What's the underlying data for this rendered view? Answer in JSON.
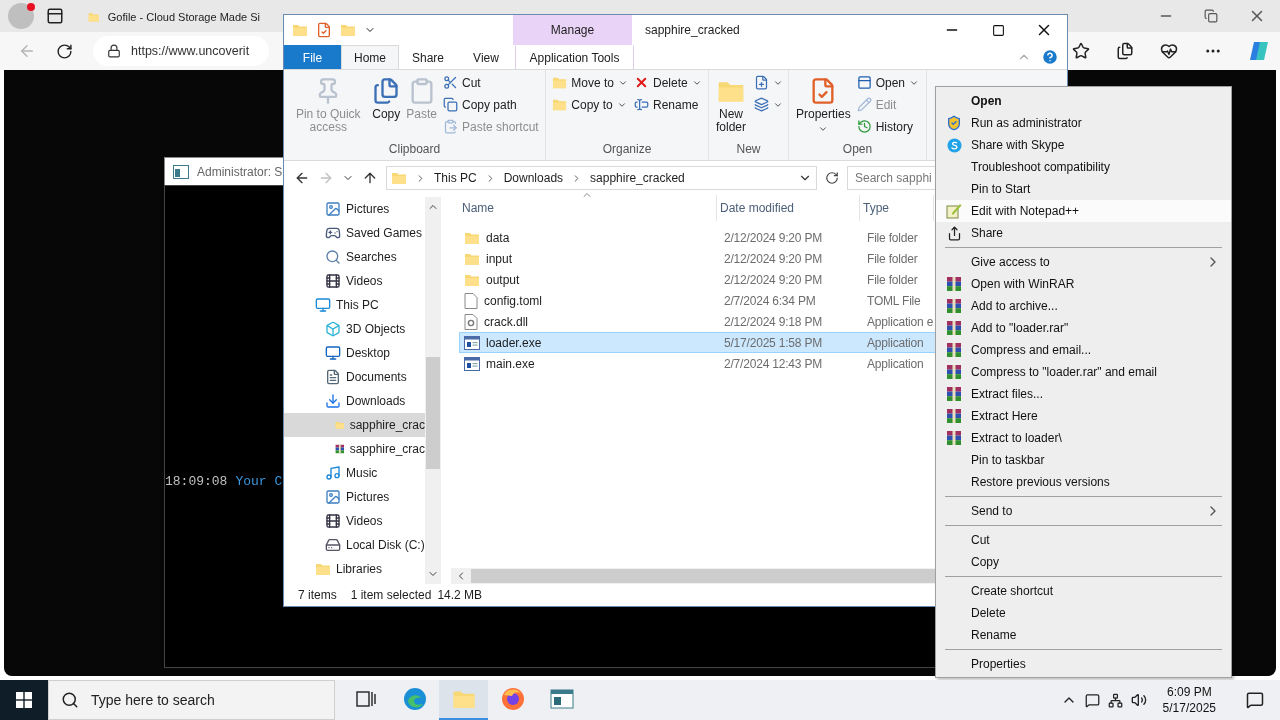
{
  "browser": {
    "tabs": [
      {
        "title": "Gofile - Cloud Storage Made Si",
        "selected": false
      }
    ],
    "address": "https://www.uncoverit"
  },
  "console": {
    "title": "Administrator: S",
    "lines": [
      {
        "time": "18:09:08",
        "message": "Your C"
      }
    ]
  },
  "explorer": {
    "title": "sapphire_cracked",
    "context_tab": {
      "group": "Manage",
      "label": "Application Tools",
      "selected": false
    },
    "ribbon_tabs": [
      {
        "label": "File",
        "kind": "file",
        "selected": false
      },
      {
        "label": "Home",
        "kind": "tab",
        "selected": true
      },
      {
        "label": "Share",
        "kind": "tab",
        "selected": false
      },
      {
        "label": "View",
        "kind": "tab",
        "selected": false
      }
    ],
    "ribbon_groups": [
      {
        "label": "Clipboard",
        "columns": [
          [
            {
              "label": "Pin to Quick access",
              "kind": "large",
              "disabled": true,
              "dropdown": false
            }
          ],
          [
            {
              "label": "Copy",
              "kind": "large",
              "disabled": false,
              "dropdown": false
            }
          ],
          [
            {
              "label": "Paste",
              "kind": "large",
              "disabled": true,
              "dropdown": false
            }
          ],
          [
            {
              "label": "Cut",
              "kind": "small",
              "disabled": false,
              "dropdown": false
            },
            {
              "label": "Copy path",
              "kind": "small",
              "disabled": false,
              "dropdown": false
            },
            {
              "label": "Paste shortcut",
              "kind": "small",
              "disabled": true,
              "dropdown": false
            }
          ]
        ]
      },
      {
        "label": "Organize",
        "columns": [
          [
            {
              "label": "Move to",
              "kind": "small",
              "disabled": false,
              "dropdown": true
            },
            {
              "label": "Copy to",
              "kind": "small",
              "disabled": false,
              "dropdown": true
            }
          ],
          [
            {
              "label": "Delete",
              "kind": "small",
              "disabled": false,
              "dropdown": true
            },
            {
              "label": "Rename",
              "kind": "small",
              "disabled": false,
              "dropdown": false
            }
          ]
        ]
      },
      {
        "label": "New",
        "columns": [
          [
            {
              "label": "New folder",
              "kind": "large",
              "disabled": false,
              "dropdown": false
            }
          ],
          [
            {
              "kind": "small",
              "disabled": false,
              "dropdown": true
            },
            {
              "kind": "small",
              "disabled": false,
              "dropdown": true
            }
          ]
        ]
      },
      {
        "label": "Open",
        "columns": [
          [
            {
              "label": "Properties",
              "kind": "large",
              "disabled": false,
              "dropdown": true
            }
          ],
          [
            {
              "label": "Open",
              "kind": "small",
              "disabled": false,
              "dropdown": true
            },
            {
              "label": "Edit",
              "kind": "small",
              "disabled": true,
              "dropdown": false
            },
            {
              "label": "History",
              "kind": "small",
              "disabled": false,
              "dropdown": false
            }
          ]
        ]
      }
    ],
    "breadcrumb": [
      "This PC",
      "Downloads",
      "sapphire_cracked"
    ],
    "search_placeholder": "Search sapphi",
    "nav_tree": {
      "scrolled_items": [
        {
          "label": "Pictures",
          "kind": "pictures",
          "selected": false
        },
        {
          "label": "Saved Games",
          "kind": "games",
          "selected": false
        },
        {
          "label": "Searches",
          "kind": "search",
          "selected": false
        },
        {
          "label": "Videos",
          "kind": "videos",
          "selected": false
        }
      ],
      "items": [
        {
          "label": "This PC",
          "kind": "pc",
          "selected": false,
          "children": [
            {
              "label": "3D Objects",
              "kind": "objects",
              "selected": false
            },
            {
              "label": "Desktop",
              "kind": "desktop",
              "selected": false
            },
            {
              "label": "Documents",
              "kind": "documents",
              "selected": false
            },
            {
              "label": "Downloads",
              "kind": "downloads",
              "selected": false,
              "children": [
                {
                  "label": "sapphire_crac",
                  "kind": "folder",
                  "selected": true
                },
                {
                  "label": "sapphire_crac",
                  "kind": "archive",
                  "selected": false
                }
              ]
            },
            {
              "label": "Music",
              "kind": "music",
              "selected": false
            },
            {
              "label": "Pictures",
              "kind": "pictures",
              "selected": false
            },
            {
              "label": "Videos",
              "kind": "videos",
              "selected": false
            },
            {
              "label": "Local Disk (C:)",
              "kind": "disk",
              "selected": false
            }
          ]
        },
        {
          "label": "Libraries",
          "kind": "libraries",
          "selected": false
        }
      ]
    },
    "columns": [
      "Name",
      "Date modified",
      "Type"
    ],
    "files": [
      {
        "name": "data",
        "date": "2/12/2024 9:20 PM",
        "type": "File folder",
        "kind": "folder",
        "selected": false
      },
      {
        "name": "input",
        "date": "2/12/2024 9:20 PM",
        "type": "File folder",
        "kind": "folder",
        "selected": false
      },
      {
        "name": "output",
        "date": "2/12/2024 9:20 PM",
        "type": "File folder",
        "kind": "folder",
        "selected": false
      },
      {
        "name": "config.toml",
        "date": "2/7/2024 6:34 PM",
        "type": "TOML File",
        "kind": "file",
        "selected": false
      },
      {
        "name": "crack.dll",
        "date": "2/12/2024 9:18 PM",
        "type": "Application e",
        "kind": "library",
        "selected": false
      },
      {
        "name": "loader.exe",
        "date": "5/17/2025 1:58 PM",
        "type": "Application",
        "kind": "program",
        "selected": true
      },
      {
        "name": "main.exe",
        "date": "2/7/2024 12:43 PM",
        "type": "Application",
        "kind": "program",
        "selected": false
      }
    ],
    "status": {
      "count": "7 items",
      "selection": "1 item selected",
      "size": "14.2 MB"
    }
  },
  "context_menu": {
    "sections": [
      [
        {
          "label": "Open",
          "kind": "plain",
          "default": true,
          "submenu": false,
          "selected": false
        },
        {
          "label": "Run as administrator",
          "kind": "shield",
          "default": false,
          "submenu": false,
          "selected": false
        },
        {
          "label": "Share with Skype",
          "kind": "skype",
          "default": false,
          "submenu": false,
          "selected": false
        },
        {
          "label": "Troubleshoot compatibility",
          "kind": "plain",
          "default": false,
          "submenu": false,
          "selected": false
        },
        {
          "label": "Pin to Start",
          "kind": "plain",
          "default": false,
          "submenu": false,
          "selected": false
        },
        {
          "label": "Edit with Notepad++",
          "kind": "notepad",
          "default": false,
          "submenu": false,
          "selected": true
        },
        {
          "label": "Share",
          "kind": "share",
          "default": false,
          "submenu": false,
          "selected": false
        }
      ],
      [
        {
          "label": "Give access to",
          "kind": "plain",
          "default": false,
          "submenu": true,
          "selected": false
        },
        {
          "label": "Open with WinRAR",
          "kind": "archive",
          "default": false,
          "submenu": false,
          "selected": false
        },
        {
          "label": "Add to archive...",
          "kind": "archive",
          "default": false,
          "submenu": false,
          "selected": false
        },
        {
          "label": "Add to \"loader.rar\"",
          "kind": "archive",
          "default": false,
          "submenu": false,
          "selected": false
        },
        {
          "label": "Compress and email...",
          "kind": "archive",
          "default": false,
          "submenu": false,
          "selected": false
        },
        {
          "label": "Compress to \"loader.rar\" and email",
          "kind": "archive",
          "default": false,
          "submenu": false,
          "selected": false
        },
        {
          "label": "Extract files...",
          "kind": "archive",
          "default": false,
          "submenu": false,
          "selected": false
        },
        {
          "label": "Extract Here",
          "kind": "archive",
          "default": false,
          "submenu": false,
          "selected": false
        },
        {
          "label": "Extract to loader\\",
          "kind": "archive",
          "default": false,
          "submenu": false,
          "selected": false
        },
        {
          "label": "Pin to taskbar",
          "kind": "plain",
          "default": false,
          "submenu": false,
          "selected": false
        },
        {
          "label": "Restore previous versions",
          "kind": "plain",
          "default": false,
          "submenu": false,
          "selected": false
        }
      ],
      [
        {
          "label": "Send to",
          "kind": "plain",
          "default": false,
          "submenu": true,
          "selected": false
        }
      ],
      [
        {
          "label": "Cut",
          "kind": "plain",
          "default": false,
          "submenu": false,
          "selected": false
        },
        {
          "label": "Copy",
          "kind": "plain",
          "default": false,
          "submenu": false,
          "selected": false
        }
      ],
      [
        {
          "label": "Create shortcut",
          "kind": "plain",
          "default": false,
          "submenu": false,
          "selected": false
        },
        {
          "label": "Delete",
          "kind": "plain",
          "default": false,
          "submenu": false,
          "selected": false
        },
        {
          "label": "Rename",
          "kind": "plain",
          "default": false,
          "submenu": false,
          "selected": false
        }
      ],
      [
        {
          "label": "Properties",
          "kind": "plain",
          "default": false,
          "submenu": false,
          "selected": false
        }
      ]
    ]
  },
  "taskbar": {
    "search_placeholder": "Type here to search",
    "apps": [
      {
        "kind": "taskview",
        "selected": false
      },
      {
        "kind": "edge",
        "selected": false
      },
      {
        "kind": "explorer",
        "selected": true
      },
      {
        "kind": "firefox",
        "selected": false
      },
      {
        "kind": "console",
        "selected": false
      }
    ],
    "time": "6:09 PM",
    "date": "5/17/2025"
  }
}
